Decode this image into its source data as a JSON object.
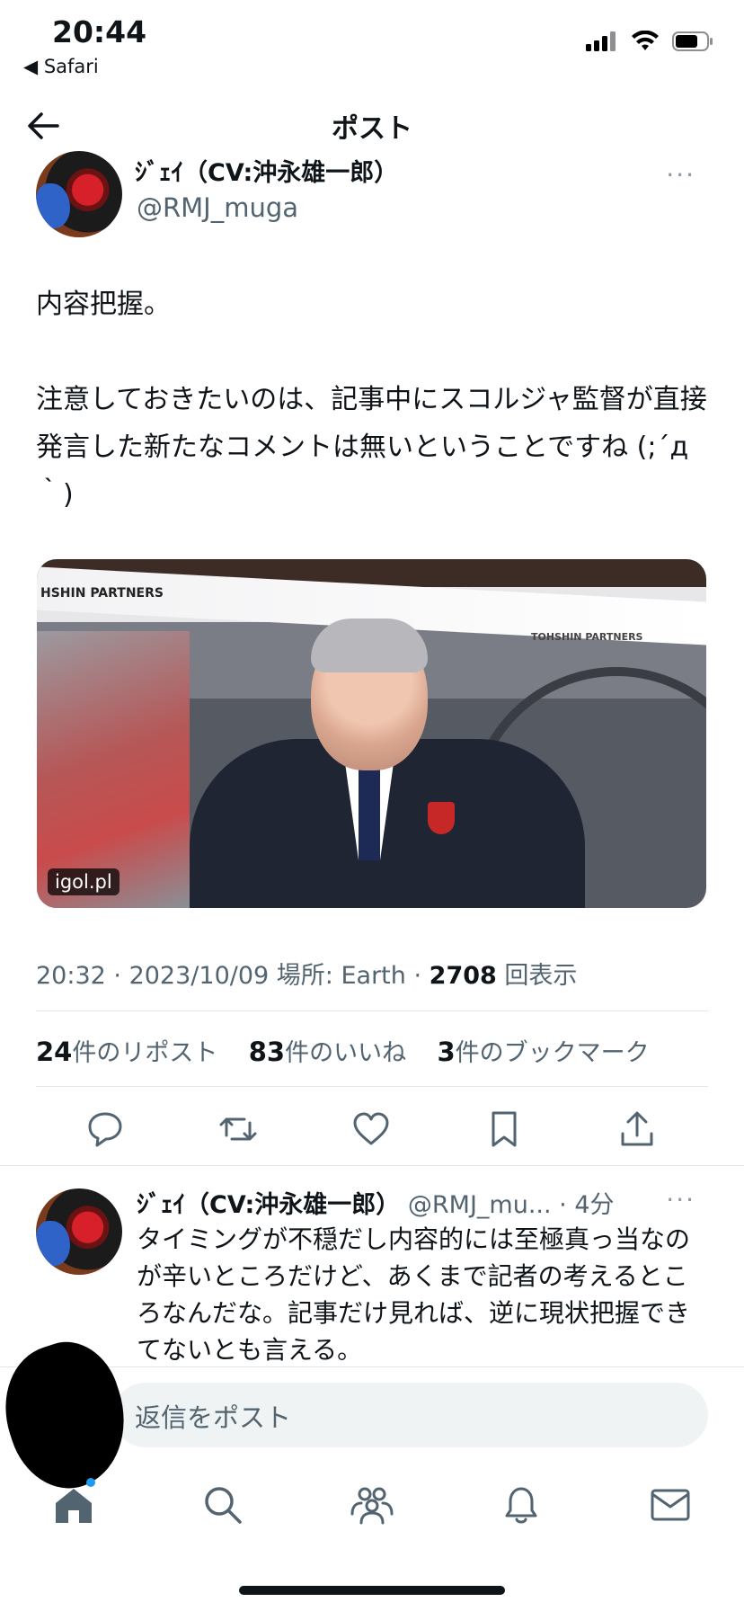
{
  "status_bar": {
    "time": "20:44",
    "back_app": "◀ Safari"
  },
  "header": {
    "title": "ポスト"
  },
  "tweet": {
    "author_name": "ｼﾞｪｲ（CV:沖永雄一郎）",
    "author_handle": "@RMJ_muga",
    "more_label": "···",
    "text": "内容把握。\n\n注意しておきたいのは、記事中にスコルジャ監督が直接発言した新たなコメントは無いということですね (;´д｀)",
    "media_source": "igol.pl",
    "media_banner_left": "HSHIN PARTNERS",
    "media_banner_right": "TOHSHIN PARTNERS",
    "time": "20:32",
    "date": "2023/10/09",
    "location_label": "場所: Earth",
    "views": "2708",
    "views_label": "回表示",
    "reposts": "24",
    "reposts_label": "件のリポスト",
    "likes": "83",
    "likes_label": "件のいいね",
    "bookmarks": "3",
    "bookmarks_label": "件のブックマーク"
  },
  "reply": {
    "author_name": "ｼﾞｪｲ（CV:沖永雄一郎）",
    "author_handle": "@RMJ_mu...",
    "time": "4分",
    "more_label": "···",
    "text": "タイミングが不穏だし内容的には至極真っ当なのが辛いところだけど、あくまで記者の考えるところなんだな。記事だけ見れば、逆に現状把握できてないとも言える。"
  },
  "reply_input": {
    "placeholder": "返信をポスト"
  },
  "colors": {
    "accent": "#1d9bf0",
    "secondary_text": "#536471",
    "icon_gray": "#536471"
  }
}
